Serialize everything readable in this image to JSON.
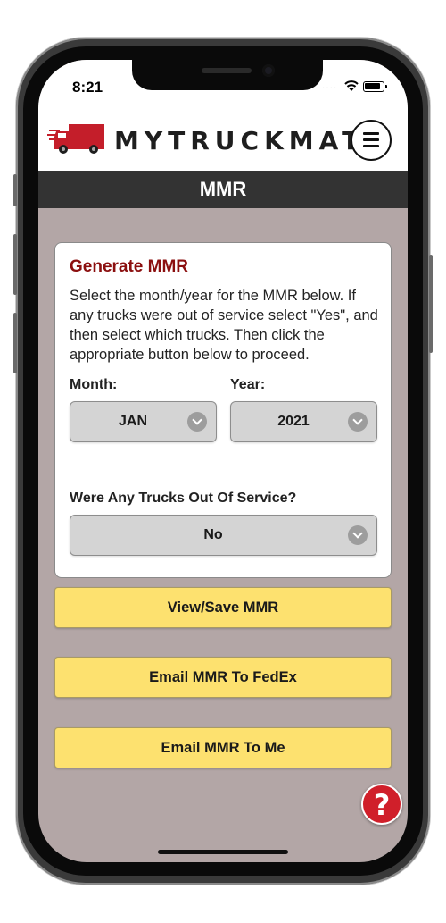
{
  "status_bar": {
    "time": "8:21",
    "signal": "····"
  },
  "header": {
    "logo_text": "MYTRUCKMATE"
  },
  "title_bar": {
    "title": "MMR"
  },
  "card": {
    "title": "Generate MMR",
    "description": "Select the month/year for the MMR below. If any trucks were out of service select \"Yes\", and then select which trucks. Then click the appropriate button below to proceed.",
    "month": {
      "label": "Month:",
      "value": "JAN"
    },
    "year": {
      "label": "Year:",
      "value": "2021"
    },
    "out_of_service": {
      "label": "Were Any Trucks Out Of Service?",
      "value": "No"
    }
  },
  "buttons": {
    "view_save": "View/Save MMR",
    "email_fedex": "Email MMR To FedEx",
    "email_me": "Email MMR To Me"
  },
  "help": {
    "label": "?"
  },
  "colors": {
    "background": "#b3a6a6",
    "title_bar": "#333333",
    "card_title": "#8b0f0f",
    "button": "#fde16f",
    "help": "#d01f2a"
  }
}
